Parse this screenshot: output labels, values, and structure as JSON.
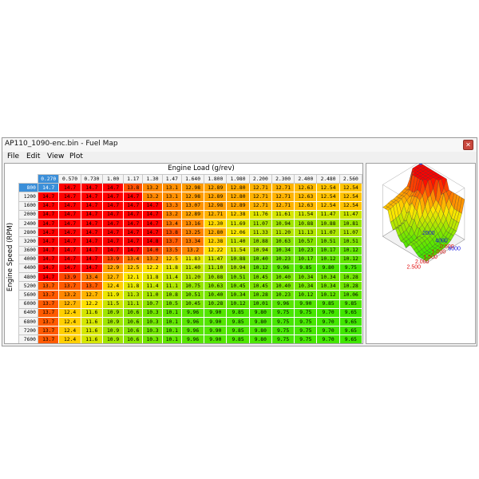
{
  "window": {
    "title": "AP110_1090-enc.bin - Fuel Map",
    "close_icon": "close-icon"
  },
  "menu": {
    "file": "File",
    "edit": "Edit",
    "view": "View",
    "plot": "Plot"
  },
  "table": {
    "x_axis_label": "Engine Load (g/rev)",
    "y_axis_label": "Engine Speed (RPM)",
    "selected_col": 0,
    "selected_row": 0,
    "columns": [
      "0.270",
      "0.570",
      "0.730",
      "1.00",
      "1.17",
      "1.30",
      "1.47",
      "1.640",
      "1.800",
      "1.980",
      "2.200",
      "2.300",
      "2.400",
      "2.480",
      "2.560"
    ],
    "rows": [
      "800",
      "1200",
      "1600",
      "2000",
      "2400",
      "2800",
      "3200",
      "3600",
      "4000",
      "4400",
      "4800",
      "5200",
      "5600",
      "6000",
      "6400",
      "6800",
      "7200",
      "7600"
    ],
    "cells": [
      [
        "14.7",
        "14.7",
        "14.7",
        "14.7",
        "13.8",
        "13.2",
        "13.1",
        "12.98",
        "12.89",
        "12.80",
        "12.71",
        "12.71",
        "12.63",
        "12.54",
        "12.54"
      ],
      [
        "14.7",
        "14.7",
        "14.7",
        "14.7",
        "14.7",
        "13.2",
        "13.1",
        "12.98",
        "12.89",
        "12.80",
        "12.71",
        "12.71",
        "12.63",
        "12.54",
        "12.54"
      ],
      [
        "14.7",
        "14.7",
        "14.7",
        "14.7",
        "14.7",
        "14.7",
        "13.3",
        "13.07",
        "12.98",
        "12.89",
        "12.71",
        "12.71",
        "12.63",
        "12.54",
        "12.54"
      ],
      [
        "14.7",
        "14.7",
        "14.7",
        "14.7",
        "14.7",
        "14.7",
        "13.2",
        "12.89",
        "12.71",
        "12.38",
        "11.76",
        "11.61",
        "11.54",
        "11.47",
        "11.47"
      ],
      [
        "14.7",
        "14.7",
        "14.7",
        "14.7",
        "14.7",
        "14.7",
        "13.4",
        "13.16",
        "12.30",
        "11.69",
        "11.07",
        "10.94",
        "10.88",
        "10.88",
        "10.81"
      ],
      [
        "14.7",
        "14.7",
        "14.7",
        "14.7",
        "14.7",
        "14.7",
        "13.8",
        "13.25",
        "12.80",
        "12.06",
        "11.33",
        "11.20",
        "11.13",
        "11.07",
        "11.07"
      ],
      [
        "14.7",
        "14.7",
        "14.7",
        "14.7",
        "14.7",
        "14.8",
        "13.7",
        "13.34",
        "12.38",
        "11.40",
        "10.88",
        "10.63",
        "10.57",
        "10.51",
        "10.51"
      ],
      [
        "14.7",
        "14.7",
        "14.7",
        "14.7",
        "14.7",
        "14.0",
        "13.5",
        "13.2",
        "12.22",
        "11.54",
        "10.94",
        "10.34",
        "10.23",
        "10.17",
        "10.12"
      ],
      [
        "14.7",
        "14.7",
        "14.7",
        "13.9",
        "13.4",
        "13.2",
        "12.5",
        "11.83",
        "11.47",
        "10.88",
        "10.40",
        "10.23",
        "10.17",
        "10.12",
        "10.12"
      ],
      [
        "14.7",
        "14.7",
        "14.7",
        "12.9",
        "12.5",
        "12.2",
        "11.8",
        "11.40",
        "11.10",
        "10.94",
        "10.12",
        "9.96",
        "9.85",
        "9.80",
        "9.75"
      ],
      [
        "14.7",
        "13.9",
        "13.4",
        "12.7",
        "12.1",
        "11.8",
        "11.4",
        "11.20",
        "10.88",
        "10.51",
        "10.45",
        "10.40",
        "10.34",
        "10.34",
        "10.28"
      ],
      [
        "13.7",
        "13.7",
        "13.7",
        "12.4",
        "11.8",
        "11.4",
        "11.1",
        "10.75",
        "10.63",
        "10.45",
        "10.45",
        "10.40",
        "10.34",
        "10.34",
        "10.28"
      ],
      [
        "13.7",
        "13.2",
        "12.7",
        "11.9",
        "11.3",
        "11.0",
        "10.8",
        "10.51",
        "10.40",
        "10.34",
        "10.28",
        "10.23",
        "10.12",
        "10.12",
        "10.06"
      ],
      [
        "13.7",
        "12.7",
        "12.2",
        "11.5",
        "11.1",
        "10.7",
        "10.5",
        "10.45",
        "10.28",
        "10.12",
        "10.01",
        "9.96",
        "9.90",
        "9.85",
        "9.85"
      ],
      [
        "13.7",
        "12.4",
        "11.6",
        "10.9",
        "10.6",
        "10.3",
        "10.1",
        "9.96",
        "9.90",
        "9.85",
        "9.80",
        "9.75",
        "9.75",
        "9.70",
        "9.65"
      ],
      [
        "13.7",
        "12.4",
        "11.6",
        "10.9",
        "10.6",
        "10.3",
        "10.1",
        "9.96",
        "9.90",
        "9.85",
        "9.80",
        "9.75",
        "9.75",
        "9.70",
        "9.65"
      ],
      [
        "13.7",
        "12.4",
        "11.6",
        "10.9",
        "10.6",
        "10.3",
        "10.1",
        "9.96",
        "9.90",
        "9.85",
        "9.80",
        "9.75",
        "9.75",
        "9.70",
        "9.65"
      ],
      [
        "13.7",
        "12.4",
        "11.6",
        "10.9",
        "10.6",
        "10.3",
        "10.1",
        "9.96",
        "9.90",
        "9.85",
        "9.80",
        "9.75",
        "9.75",
        "9.70",
        "9.65"
      ]
    ]
  },
  "plot3d": {
    "load_ticks": [
      "0.500",
      "1.000",
      "1.500",
      "2.000",
      "2.500"
    ],
    "rpm_ticks": [
      "2000",
      "4000",
      "6000"
    ],
    "load_axis_color": "#e01010",
    "rpm_axis_color": "#1010e0"
  },
  "colors": {
    "selection": "#3b8fd9",
    "rich": "#e80000",
    "lean": "#22dd00"
  }
}
